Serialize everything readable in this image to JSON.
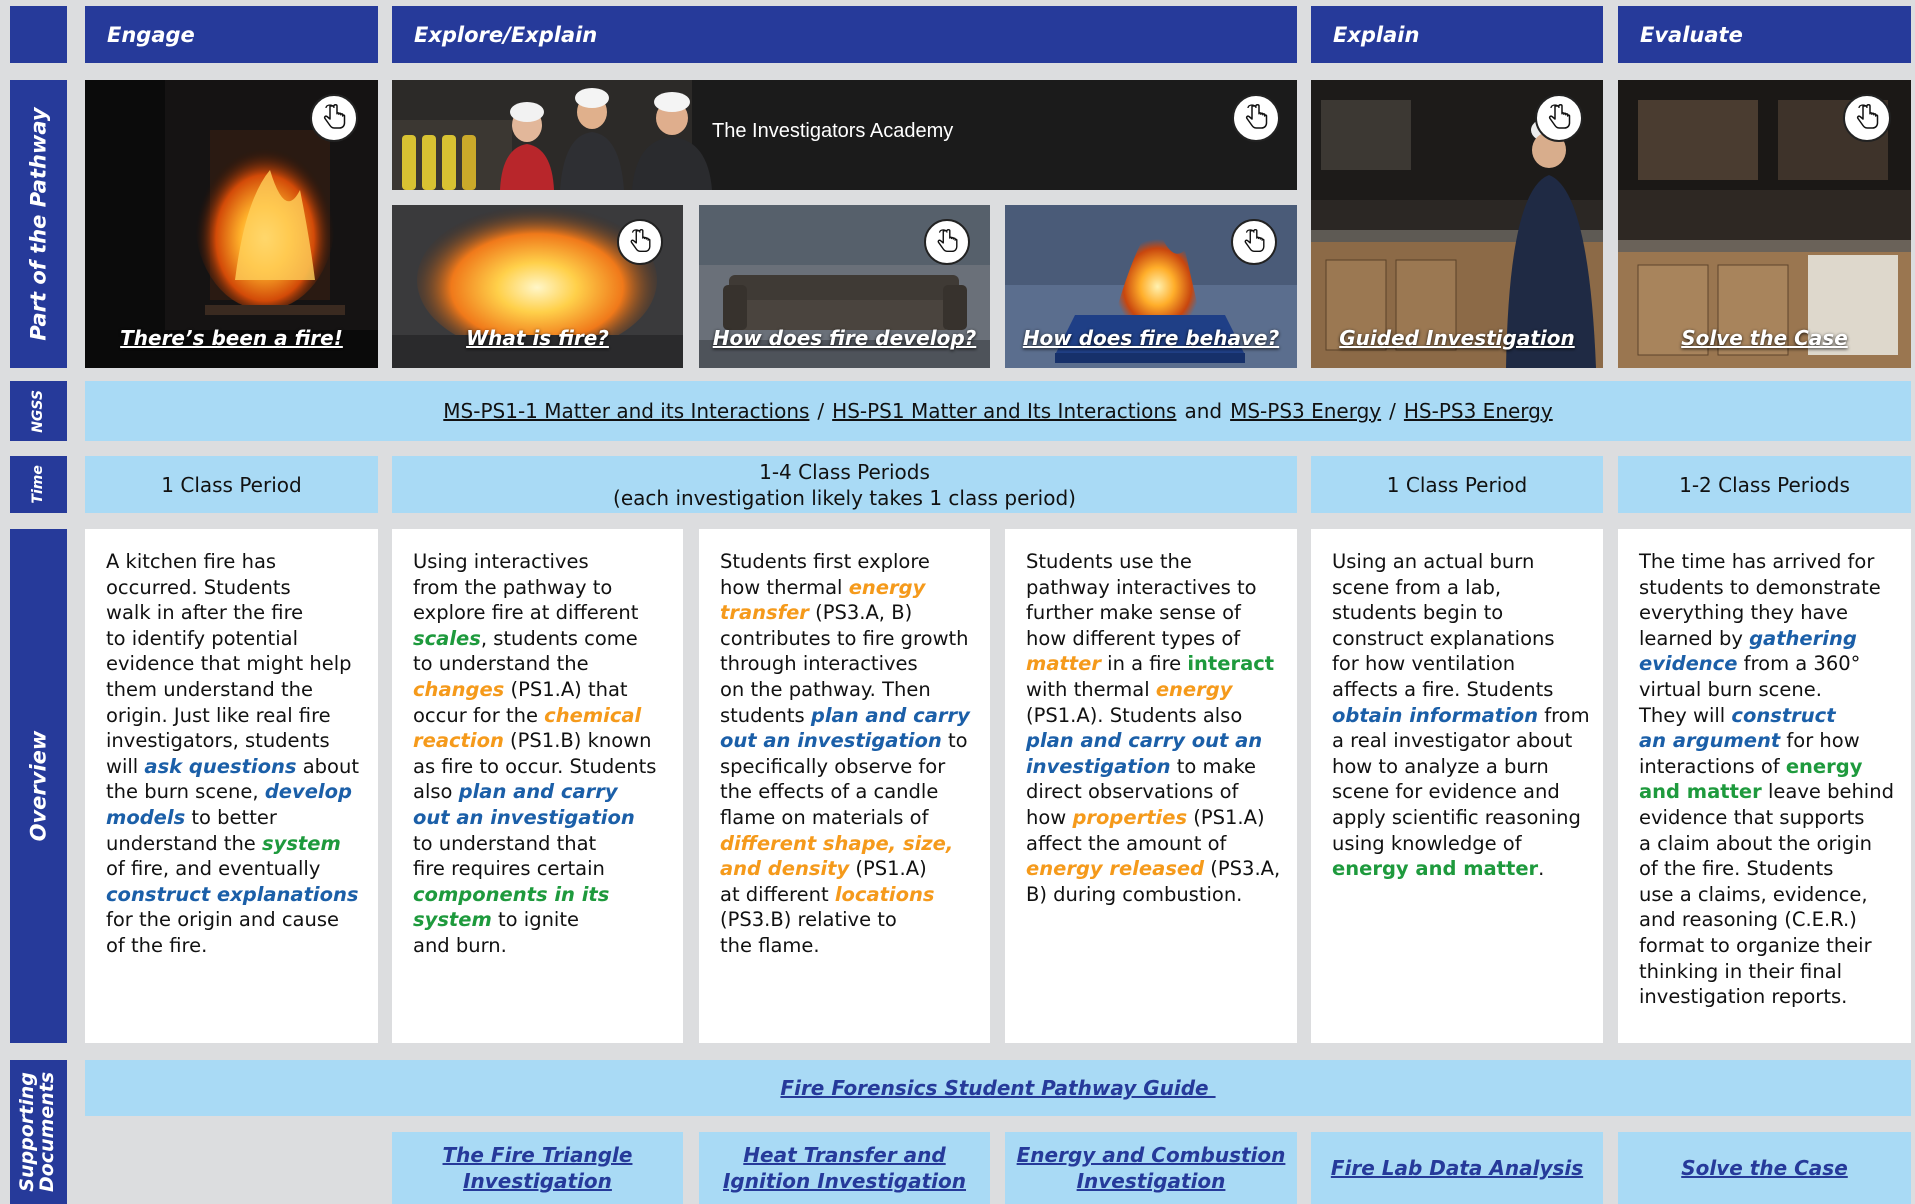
{
  "phases": [
    {
      "label": "Engage"
    },
    {
      "label": "Explore/Explain"
    },
    {
      "label": "Explain"
    },
    {
      "label": "Evaluate"
    }
  ],
  "row_labels": {
    "pathway": "Part of the Pathway",
    "ngss": "NGSS",
    "time": "Time",
    "overview": "Overview",
    "supporting_line1": "Supporting",
    "supporting_line2": "Documents"
  },
  "interactives": {
    "engage": {
      "caption": "There’s been a fire!",
      "icon": "hand-pointer-icon"
    },
    "academy": {
      "title": "The Investigators Academy",
      "icon": "hand-pointer-icon"
    },
    "what_is_fire": {
      "caption": "What is fire?",
      "icon": "hand-pointer-icon"
    },
    "fire_develop": {
      "caption": "How does fire develop?",
      "icon": "hand-pointer-icon"
    },
    "fire_behave": {
      "caption": "How does fire behave?",
      "icon": "hand-pointer-icon"
    },
    "guided": {
      "caption": "Guided Investigation",
      "icon": "hand-pointer-icon"
    },
    "solve": {
      "caption": "Solve the Case",
      "icon": "hand-pointer-icon"
    }
  },
  "ngss": {
    "link1": "MS-PS1-1 Matter and its Interactions",
    "sep1": "/",
    "link2": "HS-PS1 Matter and Its Interactions",
    "and": "and",
    "link3": "MS-PS3 Energy",
    "sep2": "/",
    "link4": "HS-PS3 Energy"
  },
  "time": {
    "engage": "1 Class Period",
    "explore_line1": "1-4 Class Periods",
    "explore_line2": "(each investigation likely takes 1 class period)",
    "explain": "1 Class Period",
    "evaluate": "1-2 Class Periods"
  },
  "overview": {
    "c1": [
      "A kitchen fire has",
      "occurred. Students",
      "walk in after the fire",
      "to identify potential",
      "evidence that might help",
      "them understand the",
      "origin. Just like real fire",
      "investigators, students",
      "will ",
      "ask questions",
      " about",
      "the burn scene, ",
      "develop",
      "models",
      " to better",
      "understand the ",
      "system",
      "of fire, and eventually",
      "construct explanations",
      "for the origin and cause",
      "of the fire."
    ],
    "c2": [
      "Using interactives",
      "from the pathway to",
      "explore fire at different",
      "scales",
      ", students come",
      "to understand the",
      "changes",
      " (PS1.A) that",
      "occur for the ",
      "chemical",
      "reaction",
      " (PS1.B) known",
      "as fire to occur. Students",
      "also ",
      "plan and carry",
      "out an investigation",
      "to understand that",
      "fire requires certain",
      "components in its",
      "system",
      " to ignite",
      "and burn."
    ],
    "c3": [
      "Students first explore",
      "how thermal ",
      "energy",
      "transfer",
      " (PS3.A, B)",
      "contributes to fire growth",
      "through interactives",
      "on the pathway. Then",
      "students ",
      "plan and carry",
      "out an investigation",
      " to",
      "specifically observe for",
      "the effects of a candle",
      "flame on materials of",
      "different shape, size,",
      "and density",
      " (PS1.A)",
      "at different ",
      "locations",
      "(PS3.B) relative to",
      "the flame."
    ],
    "c4": [
      "Students use the",
      "pathway interactives to",
      "further make sense of",
      "how different types of",
      "matter",
      " in a fire ",
      "interact",
      "with thermal ",
      "energy",
      "(PS1.A).  Students also",
      "plan and carry out an",
      "investigation",
      " to make",
      "direct observations of",
      "how ",
      "properties",
      " (PS1.A)",
      "affect the amount of",
      "energy released",
      " (PS3.A,",
      "B) during combustion."
    ],
    "c5": [
      "Using an actual burn",
      "scene from a lab,",
      "students begin to",
      "construct explanations",
      "for how ventilation",
      "affects a fire. Students",
      "obtain information",
      " from",
      "a real investigator about",
      "how to analyze a burn",
      "scene for evidence and",
      "apply scientific reasoning",
      "using knowledge of",
      "energy and matter",
      "."
    ],
    "c6": [
      "The time has arrived for",
      "students to demonstrate",
      "everything they have",
      "learned by ",
      "gathering",
      "evidence",
      " from a 360°",
      "virtual burn scene.",
      "They will ",
      "construct",
      "an argument",
      " for how",
      "interactions of ",
      "energy",
      "and matter",
      " leave behind",
      "evidence that supports",
      "a claim about the origin",
      "of the fire. Students",
      "use a claims, evidence,",
      "and reasoning (C.E.R.)",
      "format to organize their",
      "thinking in their final",
      "investigation reports."
    ]
  },
  "documents": {
    "guide": "Fire Forensics Student Pathway Guide ",
    "triangle_line1": "The Fire Triangle",
    "triangle_line2": "Investigation",
    "heat_line1": "Heat Transfer and",
    "heat_line2": "Ignition Investigation",
    "energy_line1": "Energy and Combustion",
    "energy_line2": "Investigation",
    "lab": "Fire Lab Data Analysis",
    "solve": "Solve the Case"
  },
  "colors": {
    "navy": "#263a9a",
    "light_blue": "#a9daf5",
    "background": "#dcdddf",
    "keyword_blue": "#1b5fa8",
    "keyword_orange": "#f59a1b",
    "keyword_green": "#1e9a3d"
  }
}
